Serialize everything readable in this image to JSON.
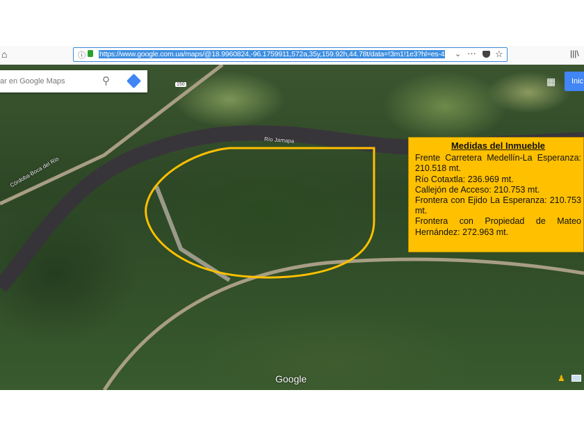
{
  "browser": {
    "url": "https://www.google.com.ua/maps/@18.9960824,-96.1759911,572a,35y,159.92h,44.78t/data=!3m1!1e3?hl=es-4"
  },
  "maps": {
    "search_placeholder": "ar en Google Maps",
    "signin_label": "Inic",
    "watermark": "Google",
    "labels": {
      "river": "Río Jamapa",
      "road": "Córdoba-Boca del Río",
      "highway": "150"
    }
  },
  "overlay": {
    "outline_color": "#ffc000"
  },
  "info_box": {
    "title": "Medidas del Inmueble",
    "background": "#ffc000",
    "lines": [
      "Frente Carretera Medellín-La Esperanza: 210.518 mt.",
      "Río Cotaxtla: 236.969 mt.",
      "Callejón de Acceso: 210.753 mt.",
      "Frontera con Ejido La Esperanza: 210.753 mt.",
      "Frontera con Propiedad de Mateo Hernández: 272.963 mt."
    ]
  }
}
